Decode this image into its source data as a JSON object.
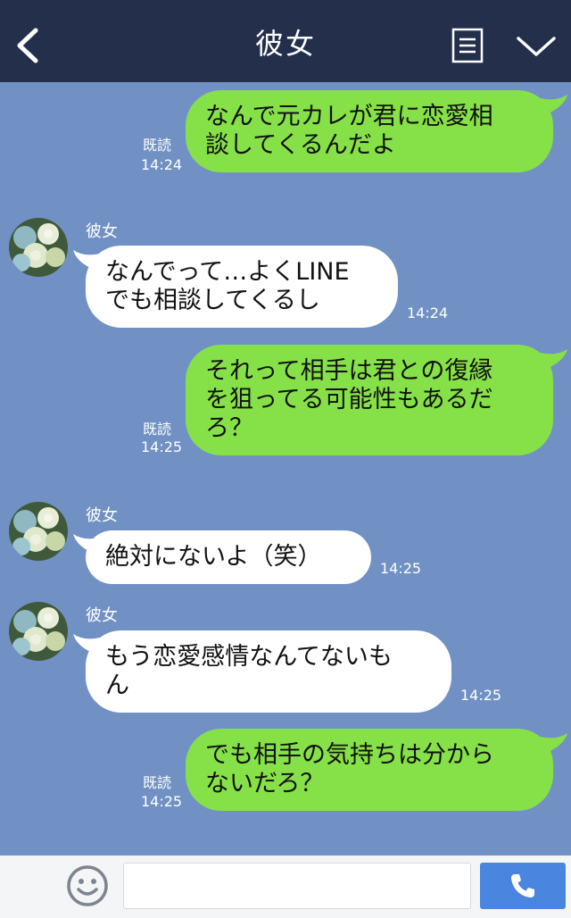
{
  "header": {
    "title": "彼女",
    "back_icon": "chevron-left-icon",
    "menu_icon": "list-icon",
    "dropdown_icon": "chevron-down-icon"
  },
  "colors": {
    "header_bg": "#232f4b",
    "chat_bg": "#7191c4",
    "outgoing_bubble": "#86e148",
    "incoming_bubble": "#ffffff",
    "send_button": "#4a86df"
  },
  "messages": [
    {
      "direction": "out",
      "text_line1": "なんで元カレが君に恋愛相",
      "text_line2": "談してくるんだよ",
      "read": "既読",
      "time": "14:24"
    },
    {
      "direction": "in",
      "sender": "彼女",
      "text_line1": "なんでって…よくLINE",
      "text_line2": "でも相談してくるし",
      "time": "14:24"
    },
    {
      "direction": "out",
      "text_line1": "それって相手は君との復縁",
      "text_line2": "を狙ってる可能性もあるだ",
      "text_line3": "ろ？",
      "read": "既読",
      "time": "14:25"
    },
    {
      "direction": "in",
      "sender": "彼女",
      "text_line1": "絶対にないよ（笑）",
      "time": "14:25"
    },
    {
      "direction": "in",
      "sender": "彼女",
      "text_line1": "もう恋愛感情なんてないも",
      "text_line2": "ん",
      "time": "14:25"
    },
    {
      "direction": "out",
      "text_line1": "でも相手の気持ちは分から",
      "text_line2": "ないだろ？",
      "read": "既読",
      "time": "14:25"
    }
  ],
  "footer": {
    "plus_icon": "plus-icon",
    "emoji_icon": "smiley-icon",
    "input_value": "",
    "call_icon": "phone-icon"
  }
}
